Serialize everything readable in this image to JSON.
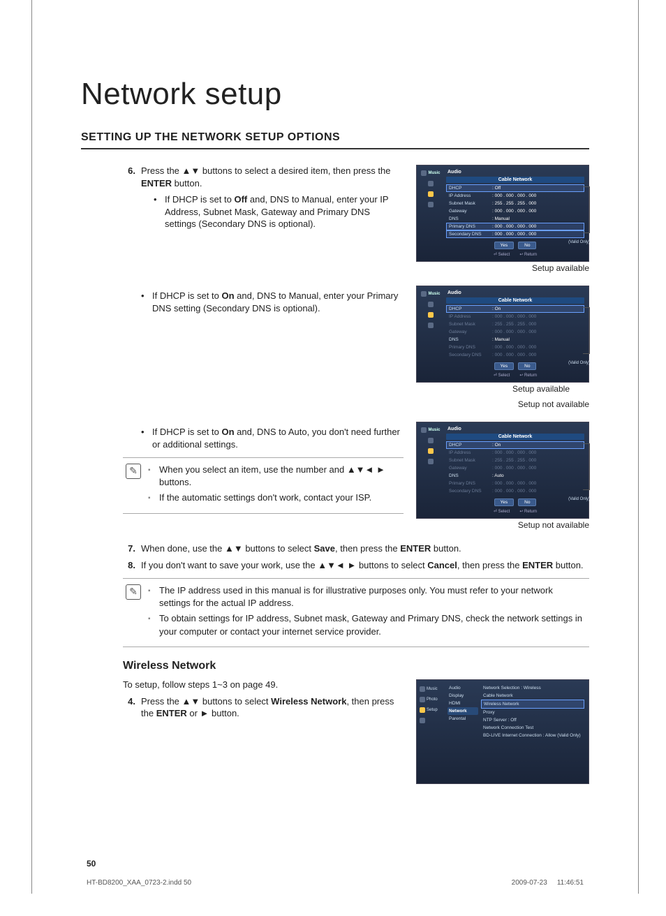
{
  "page": {
    "title": "Network setup",
    "section_title": "SETTING UP THE NETWORK SETUP OPTIONS",
    "number": "50"
  },
  "steps": {
    "s6_num": "6.",
    "s6_a": "Press the ",
    "s6_b": " buttons to select a desired item, then press the ",
    "s6_c": " button.",
    "s6_sub1_a": "If DHCP is set to ",
    "s6_sub1_b": " and, DNS to Manual, enter your IP Address, Subnet Mask, Gateway and Primary DNS settings (Secondary DNS is optional).",
    "s6_sub2_a": "If DHCP is set to ",
    "s6_sub2_b": " and, DNS to Manual, enter your Primary DNS setting (Secondary DNS is optional).",
    "s6_sub3_a": "If DHCP is set to ",
    "s6_sub3_b": " and, DNS to Auto, you don't need further or additional settings.",
    "s7_num": "7.",
    "s7_a": "When done, use the ",
    "s7_b": " buttons to select ",
    "s7_c": ", then press the ",
    "s7_d": " button.",
    "s8_num": "8.",
    "s8_a": "If you don't want to save your work, use the ",
    "s8_b": " buttons to select ",
    "s8_c": ", then press the ",
    "s8_d": " button.",
    "bold_off": "Off",
    "bold_on": "On",
    "bold_enter": "ENTER",
    "bold_save": "Save",
    "bold_cancel": "Cancel",
    "arrows_ud": "▲▼",
    "arrows_all": "▲▼◄ ►",
    "arrow_r": "►"
  },
  "tips": {
    "t1": "When you select an item, use the number and ▲▼◄ ► buttons.",
    "t2": "If the automatic settings don't work, contact your ISP.",
    "n1": "The IP address used in this manual is for illustrative purposes only. You must refer to your network settings for the actual IP address.",
    "n2": "To obtain settings for IP address, Subnet mask, Gateway and Primary DNS, check the network settings in your computer or contact your internet service provider."
  },
  "wireless": {
    "heading": "Wireless Network",
    "intro": "To setup, follow steps 1~3 on page 49.",
    "s4_num": "4.",
    "s4_a": "Press the ",
    "s4_b": " buttons to select ",
    "s4_c": ", then press the ",
    "s4_d": " or ",
    "s4_e": " button.",
    "bold_wn": "Wireless Network"
  },
  "captions": {
    "avail": "Setup available",
    "notavail": "Setup not available"
  },
  "panel_common": {
    "sb_music": "Music",
    "sb_photo": "Photo",
    "sb_setup": "Setup",
    "hdr": "Audio",
    "subhdr": "Cable Network",
    "lbl_dhcp": "DHCP",
    "lbl_ip": "IP Address",
    "lbl_subnet": "Subnet Mask",
    "lbl_gateway": "Gateway",
    "lbl_dns": "DNS",
    "lbl_pdns": "Primary DNS",
    "lbl_sdns": "Secondary DNS",
    "btn_yes": "Yes",
    "btn_no": "No",
    "hint_select": "Select",
    "hint_return": "Return",
    "valid": "(Valid Only)"
  },
  "panel1": {
    "dhcp": ": Off",
    "ip": ": 000 . 000 . 000 . 000",
    "subnet": ": 255 . 255 . 255 . 000",
    "gateway": ": 000 . 000 . 000 . 000",
    "dns": ": Manual",
    "pdns": ": 000 . 000 . 000 . 000",
    "sdns": ": 000 . 000 . 000 . 000"
  },
  "panel2": {
    "dhcp": ": On",
    "ip": ": 000 . 000 . 000 . 000",
    "subnet": ": 255 . 255 . 255 . 000",
    "gateway": ": 000 . 000 . 000 . 000",
    "dns": ": Manual",
    "pdns": ": 000 . 000 . 000 . 000",
    "sdns": ": 000 . 000 . 000 . 000"
  },
  "panel3": {
    "dhcp": ": On",
    "ip": ": 000 . 000 . 000 . 000",
    "subnet": ": 255 . 255 . 255 . 000",
    "gateway": ": 000 . 000 . 000 . 000",
    "dns": ": Auto",
    "pdns": ": 000 . 000 . 000 . 000",
    "sdns": ": 000 . 000 . 000 . 000"
  },
  "wpanel": {
    "menu_audio": "Audio",
    "menu_display": "Display",
    "menu_hdmi": "HDMI",
    "menu_network": "Network",
    "menu_parental": "Parental",
    "line_sel": "Network Selection : Wireless",
    "line_cable": "Cable Network",
    "line_wireless_sel": "Wireless Network",
    "line_proxy": "Proxy",
    "line_ntp": "NTP Server            : Off",
    "line_nct": "Network Connection Test",
    "line_bdlive": "BD-LIVE Internet Connection   : Allow (Valid Only)"
  },
  "footer": {
    "file": "HT-BD8200_XAA_0723-2.indd   50",
    "date": "2009-07-23",
    "time": "11:46:51"
  }
}
